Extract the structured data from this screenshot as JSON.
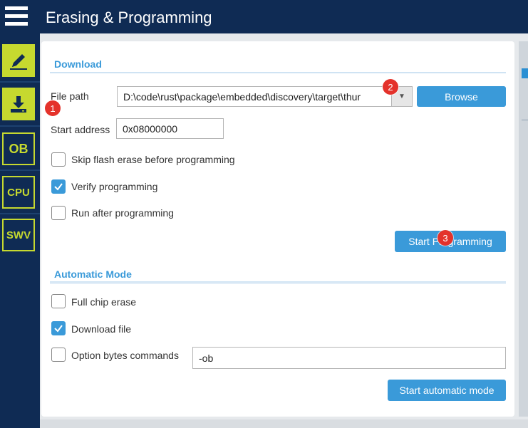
{
  "header": {
    "title": "Erasing & Programming"
  },
  "sidebar": {
    "items": [
      {
        "name": "edit",
        "icon": "pencil-icon",
        "label": ""
      },
      {
        "name": "download",
        "icon": "download-icon",
        "label": ""
      },
      {
        "name": "ob",
        "icon": "ob-icon",
        "label": "OB"
      },
      {
        "name": "cpu",
        "icon": "cpu-icon",
        "label": "CPU"
      },
      {
        "name": "swv",
        "icon": "swv-icon",
        "label": "SWV"
      }
    ]
  },
  "download": {
    "section_title": "Download",
    "file_path_label": "File path",
    "file_path_value": "D:\\code\\rust\\package\\embedded\\discovery\\target\\thur",
    "browse_label": "Browse",
    "start_address_label": "Start address",
    "start_address_value": "0x08000000",
    "options": [
      {
        "label": "Skip flash erase before programming",
        "checked": false
      },
      {
        "label": "Verify programming",
        "checked": true
      },
      {
        "label": "Run after programming",
        "checked": false
      }
    ],
    "start_programming_label": "Start Programming"
  },
  "automatic": {
    "section_title": "Automatic Mode",
    "options": [
      {
        "label": "Full chip erase",
        "checked": false
      },
      {
        "label": "Download file",
        "checked": true
      },
      {
        "label": "Option bytes commands",
        "checked": false
      }
    ],
    "ob_commands_value": "-ob",
    "start_automatic_label": "Start automatic mode"
  },
  "badges": [
    "1",
    "2",
    "3"
  ],
  "colors": {
    "navy": "#0f2b54",
    "accent": "#3a9ad9",
    "lime": "#c6d92f",
    "badge": "#e4322b"
  }
}
